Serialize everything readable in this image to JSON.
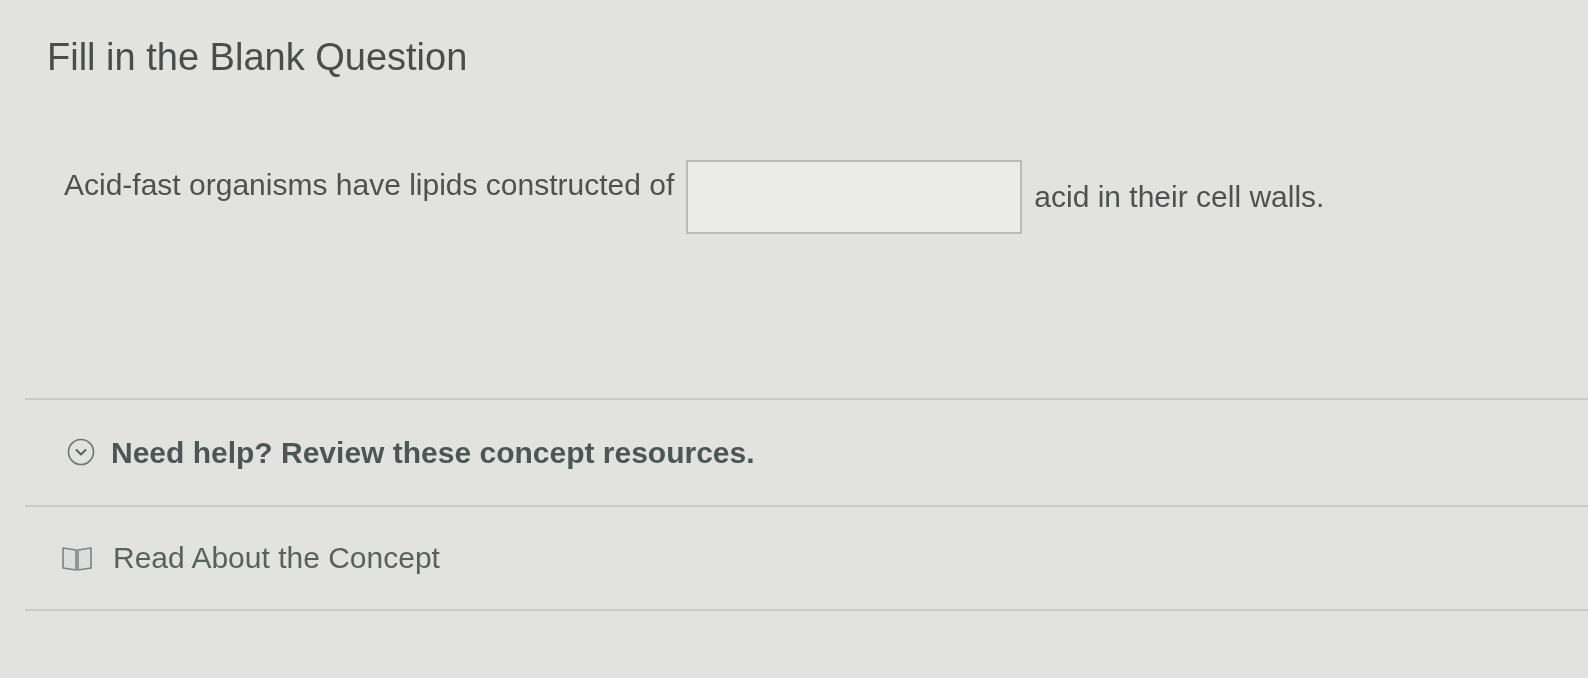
{
  "question": {
    "title": "Fill in the Blank Question",
    "prompt_before": "Acid-fast organisms have lipids constructed of",
    "prompt_after": "acid in their cell walls."
  },
  "help": {
    "label": "Need help? Review these concept resources.",
    "resources": [
      {
        "kind": "read",
        "label": "Read About the Concept"
      }
    ]
  }
}
